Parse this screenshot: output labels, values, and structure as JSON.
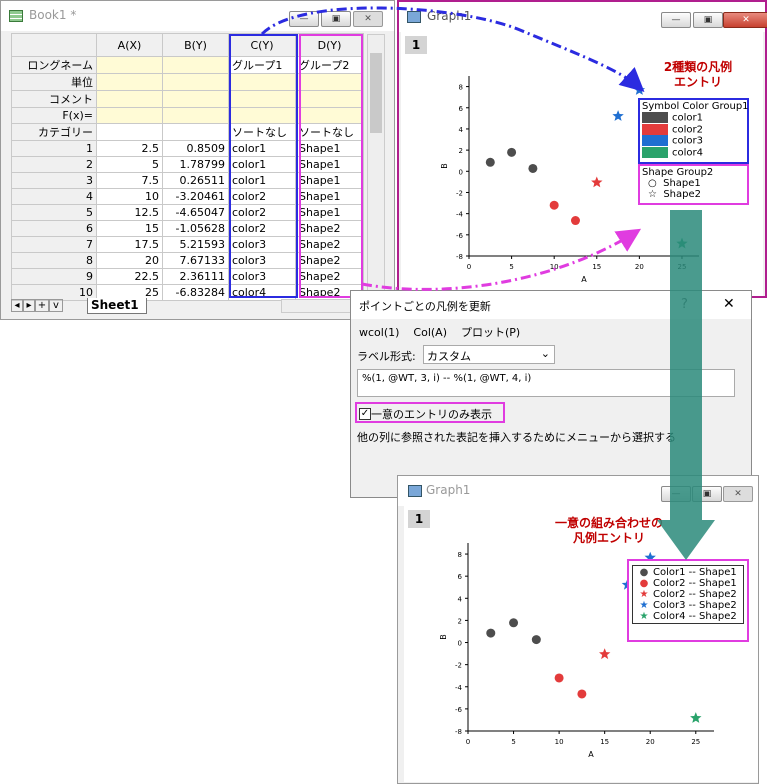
{
  "book": {
    "title": "Book1 *",
    "col_headers": [
      "A(X)",
      "B(Y)",
      "C(Y)",
      "D(Y)"
    ],
    "row_labels": [
      "ロングネーム",
      "単位",
      "コメント",
      "F(x)=",
      "カテゴリー"
    ],
    "longname": [
      "",
      "",
      "グループ1",
      "グループ2"
    ],
    "category": [
      "",
      "",
      "ソートなし",
      "ソートなし"
    ],
    "rows": [
      [
        "1",
        "2.5",
        "0.8509",
        "color1",
        "Shape1"
      ],
      [
        "2",
        "5",
        "1.78799",
        "color1",
        "Shape1"
      ],
      [
        "3",
        "7.5",
        "0.26511",
        "color1",
        "Shape1"
      ],
      [
        "4",
        "10",
        "-3.20461",
        "color2",
        "Shape1"
      ],
      [
        "5",
        "12.5",
        "-4.65047",
        "color2",
        "Shape1"
      ],
      [
        "6",
        "15",
        "-1.05628",
        "color2",
        "Shape2"
      ],
      [
        "7",
        "17.5",
        "5.21593",
        "color3",
        "Shape2"
      ],
      [
        "8",
        "20",
        "7.67133",
        "color3",
        "Shape2"
      ],
      [
        "9",
        "22.5",
        "2.36111",
        "color3",
        "Shape2"
      ],
      [
        "10",
        "25",
        "-6.83284",
        "color4",
        "Shape2"
      ]
    ],
    "sheet_tab": "Sheet1",
    "nav_plus": "+",
    "nav_v": "v"
  },
  "graph1": {
    "title": "Graph1",
    "page": "1",
    "xlabel": "A",
    "ylabel": "B",
    "annotation": [
      "2種類の凡例",
      "エントリ"
    ],
    "legend_color_title": "Symbol Color  Group1",
    "legend_color_items": [
      {
        "label": "color1",
        "color": "#4d4d4d"
      },
      {
        "label": "color2",
        "color": "#e33b3b"
      },
      {
        "label": "color3",
        "color": "#1f6fd1"
      },
      {
        "label": "color4",
        "color": "#2aa36b"
      }
    ],
    "legend_shape_title": "Shape  Group2",
    "legend_shape_items": [
      "Shape1",
      "Shape2"
    ]
  },
  "graph2": {
    "title": "Graph1",
    "page": "1",
    "xlabel": "A",
    "ylabel": "B",
    "annotation": [
      "一意の組み合わせの",
      "凡例エントリ"
    ],
    "legend_items": [
      {
        "label": "Color1 -- Shape1",
        "color": "#4d4d4d",
        "shape": "circle"
      },
      {
        "label": "Color2 -- Shape1",
        "color": "#e33b3b",
        "shape": "circle"
      },
      {
        "label": "Color2 -- Shape2",
        "color": "#e33b3b",
        "shape": "star"
      },
      {
        "label": "Color3 -- Shape2",
        "color": "#1f6fd1",
        "shape": "star"
      },
      {
        "label": "Color4 -- Shape2",
        "color": "#2aa36b",
        "shape": "star"
      }
    ]
  },
  "dialog": {
    "title": "ポイントごとの凡例を更新",
    "help": "?",
    "close": "✕",
    "menu": [
      "wcol(1)",
      "Col(A)",
      "プロット(P)"
    ],
    "label_format_label": "ラベル形式:",
    "label_format_value": "カスタム",
    "expression": "%(1, @WT, 3, i) -- %(1, @WT, 4, i)",
    "unique_checkbox": "一意のエントリのみ表示",
    "hint": "他の列に参照された表記を挿入するためにメニューから選択する"
  },
  "chart_data": [
    {
      "type": "scatter",
      "xlabel": "A",
      "ylabel": "B",
      "xlim": [
        0,
        27
      ],
      "ylim": [
        -8,
        9
      ],
      "xticks": [
        0,
        5,
        10,
        15,
        20,
        25
      ],
      "yticks": [
        -8,
        -6,
        -4,
        -2,
        0,
        2,
        4,
        6,
        8
      ],
      "series": [
        {
          "color": "#4d4d4d",
          "shape": "circle",
          "x": [
            2.5,
            5,
            7.5
          ],
          "y": [
            0.8509,
            1.78799,
            0.26511
          ]
        },
        {
          "color": "#e33b3b",
          "shape": "circle",
          "x": [
            10,
            12.5
          ],
          "y": [
            -3.20461,
            -4.65047
          ]
        },
        {
          "color": "#e33b3b",
          "shape": "star",
          "x": [
            15
          ],
          "y": [
            -1.05628
          ]
        },
        {
          "color": "#1f6fd1",
          "shape": "star",
          "x": [
            17.5,
            20
          ],
          "y": [
            5.21593,
            7.67133
          ]
        },
        {
          "color": "#2aa36b",
          "shape": "star",
          "x": [
            25
          ],
          "y": [
            -6.83284
          ]
        }
      ]
    }
  ]
}
